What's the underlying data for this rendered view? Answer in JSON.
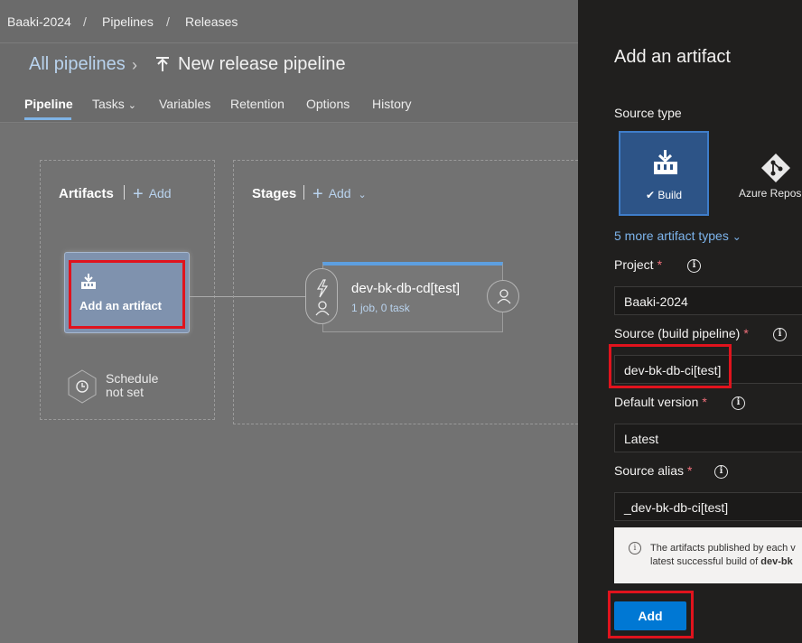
{
  "breadcrumb": {
    "items": [
      "Baaki-2024",
      "Pipelines",
      "Releases"
    ],
    "separator": "/"
  },
  "header": {
    "parent_link": "All pipelines",
    "title": "New release pipeline"
  },
  "tabs": [
    {
      "label": "Pipeline",
      "active": true
    },
    {
      "label": "Tasks",
      "has_dropdown": true
    },
    {
      "label": "Variables"
    },
    {
      "label": "Retention"
    },
    {
      "label": "Options"
    },
    {
      "label": "History"
    }
  ],
  "artifacts": {
    "title": "Artifacts",
    "add_label": "Add",
    "card_label": "Add an artifact",
    "schedule_line1": "Schedule",
    "schedule_line2": "not set"
  },
  "stages": {
    "title": "Stages",
    "add_label": "Add",
    "stage_name": "dev-bk-db-cd[test]",
    "stage_sub": "1 job, 0 task"
  },
  "panel": {
    "title": "Add an artifact",
    "source_type_label": "Source type",
    "source_types": [
      "Build",
      "Azure Repos"
    ],
    "selected_source_type": "Build",
    "more_types": "5 more artifact types",
    "project_label": "Project",
    "project_value": "Baaki-2024",
    "source_label": "Source (build pipeline)",
    "source_value": "dev-bk-db-ci[test]",
    "default_version_label": "Default version",
    "default_version_value": "Latest",
    "alias_label": "Source alias",
    "alias_value": "_dev-bk-db-ci[test]",
    "info_line1": "The artifacts published by each v",
    "info_line2_prefix": "latest successful build of ",
    "info_line2_bold": "dev-bk",
    "add_button": "Add"
  },
  "colors": {
    "accent": "#0078d4",
    "highlight_box": "#e0131d",
    "link": "#b9d3ee",
    "panel_bg": "#201f1e"
  }
}
